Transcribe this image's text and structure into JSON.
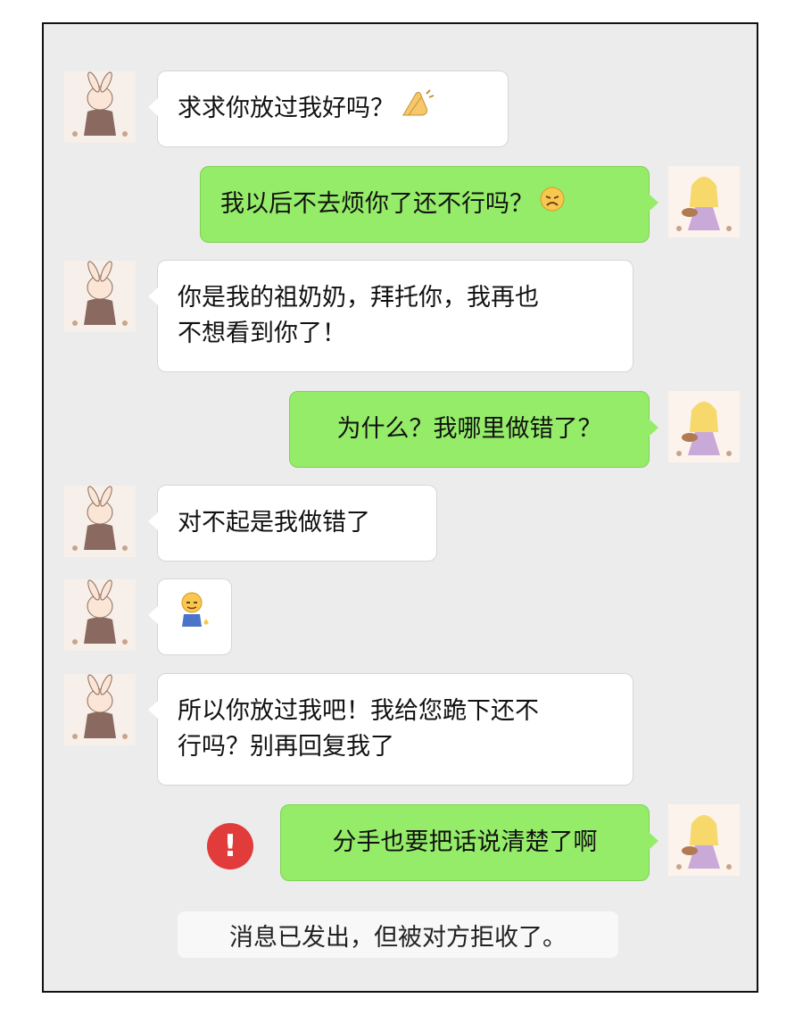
{
  "messages": [
    {
      "side": "left",
      "text": "求求你放过我好吗？",
      "emoji": "pray-hands-icon"
    },
    {
      "side": "right",
      "text": "我以后不去烦你了还不行吗？",
      "emoji": "worried-face-icon"
    },
    {
      "side": "left",
      "text": "你是我的祖奶奶，拜托你，我再也\n不想看到你了！"
    },
    {
      "side": "right",
      "text": "为什么？我哪里做错了？"
    },
    {
      "side": "left",
      "text": "对不起是我做错了"
    },
    {
      "side": "left",
      "text": "",
      "emoji": "kneeling-figure-icon"
    },
    {
      "side": "left",
      "text": "所以你放过我吧！我给您跪下还不\n行吗？别再回复我了"
    },
    {
      "side": "right",
      "text": "分手也要把话说清楚了啊",
      "status": "failed"
    }
  ],
  "error_icon": {
    "glyph": "!"
  },
  "system_note": "消息已发出，但被对方拒收了。",
  "colors": {
    "background": "#ececec",
    "left_bubble": "#ffffff",
    "right_bubble": "#95ec69",
    "error": "#e23b3b"
  }
}
